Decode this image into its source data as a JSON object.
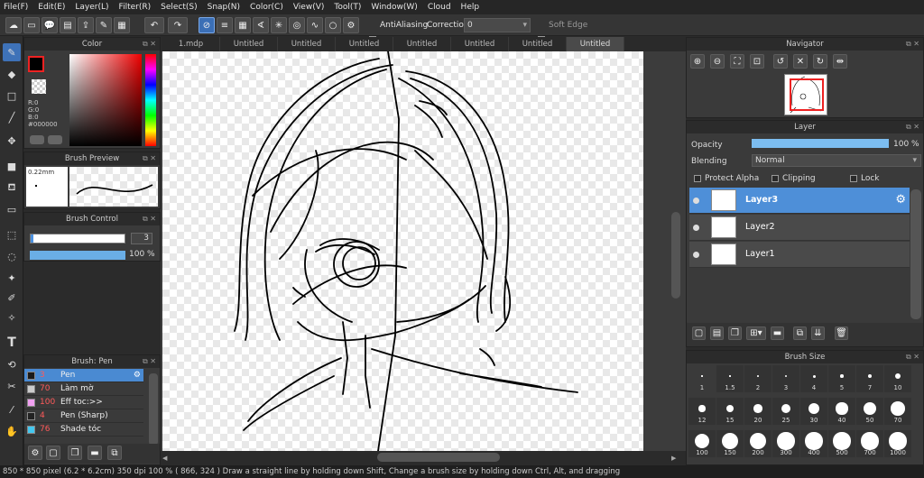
{
  "menu": [
    "File(F)",
    "Edit(E)",
    "Layer(L)",
    "Filter(R)",
    "Select(S)",
    "Snap(N)",
    "Color(C)",
    "View(V)",
    "Tool(T)",
    "Window(W)",
    "Cloud",
    "Help"
  ],
  "toolbar": {
    "antialiasing_label": "AntiAliasing",
    "correction_label": "Correction",
    "correction_value": "0",
    "soft_edge_label": "Soft Edge"
  },
  "tabs": [
    "1.mdp",
    "Untitled",
    "Untitled",
    "Untitled",
    "Untitled",
    "Untitled",
    "Untitled",
    "Untitled"
  ],
  "color_panel": {
    "title": "Color",
    "r": "R:0",
    "g": "G:0",
    "b": "B:0",
    "hex": "#000000"
  },
  "brush_preview": {
    "title": "Brush Preview",
    "size": "0.22mm"
  },
  "brush_control": {
    "title": "Brush Control",
    "size_value": "3",
    "opacity_value": "100 %"
  },
  "brush_list": {
    "title": "Brush: Pen",
    "items": [
      {
        "size": "3",
        "name": "Pen",
        "color": "#ffffff"
      },
      {
        "size": "70",
        "name": "Làm mờ",
        "color": "#cccccc"
      },
      {
        "size": "100",
        "name": "Eff toc:>>",
        "color": "#f0a0f0"
      },
      {
        "size": "4",
        "name": "Pen (Sharp)",
        "color": "#222222"
      },
      {
        "size": "76",
        "name": "Shade tóc",
        "color": "#44c8f0"
      }
    ]
  },
  "navigator": {
    "title": "Navigator"
  },
  "layer_panel": {
    "title": "Layer",
    "opacity_label": "Opacity",
    "opacity_value": "100 %",
    "opacity_fraction": 1.0,
    "blending_label": "Blending",
    "blending_value": "Normal",
    "protect_alpha": "Protect Alpha",
    "clipping": "Clipping",
    "lock": "Lock",
    "layers": [
      {
        "name": "Layer3",
        "selected": true
      },
      {
        "name": "Layer2",
        "selected": false
      },
      {
        "name": "Layer1",
        "selected": false
      }
    ]
  },
  "brush_size": {
    "title": "Brush Size",
    "sizes": [
      "1",
      "1.5",
      "2",
      "3",
      "4",
      "5",
      "7",
      "10",
      "12",
      "15",
      "20",
      "25",
      "30",
      "40",
      "50",
      "70",
      "100",
      "150",
      "200",
      "300",
      "400",
      "500",
      "700",
      "1000"
    ]
  },
  "status_text": "850 * 850 pixel  (6.2 * 6.2cm)  350 dpi  100 %  ( 866, 324 )  Draw a straight line by holding down Shift, Change a brush size by holding down Ctrl, Alt, and dragging",
  "colors": {
    "accent": "#3e72b8",
    "selected_row": "#4a8ad2"
  }
}
